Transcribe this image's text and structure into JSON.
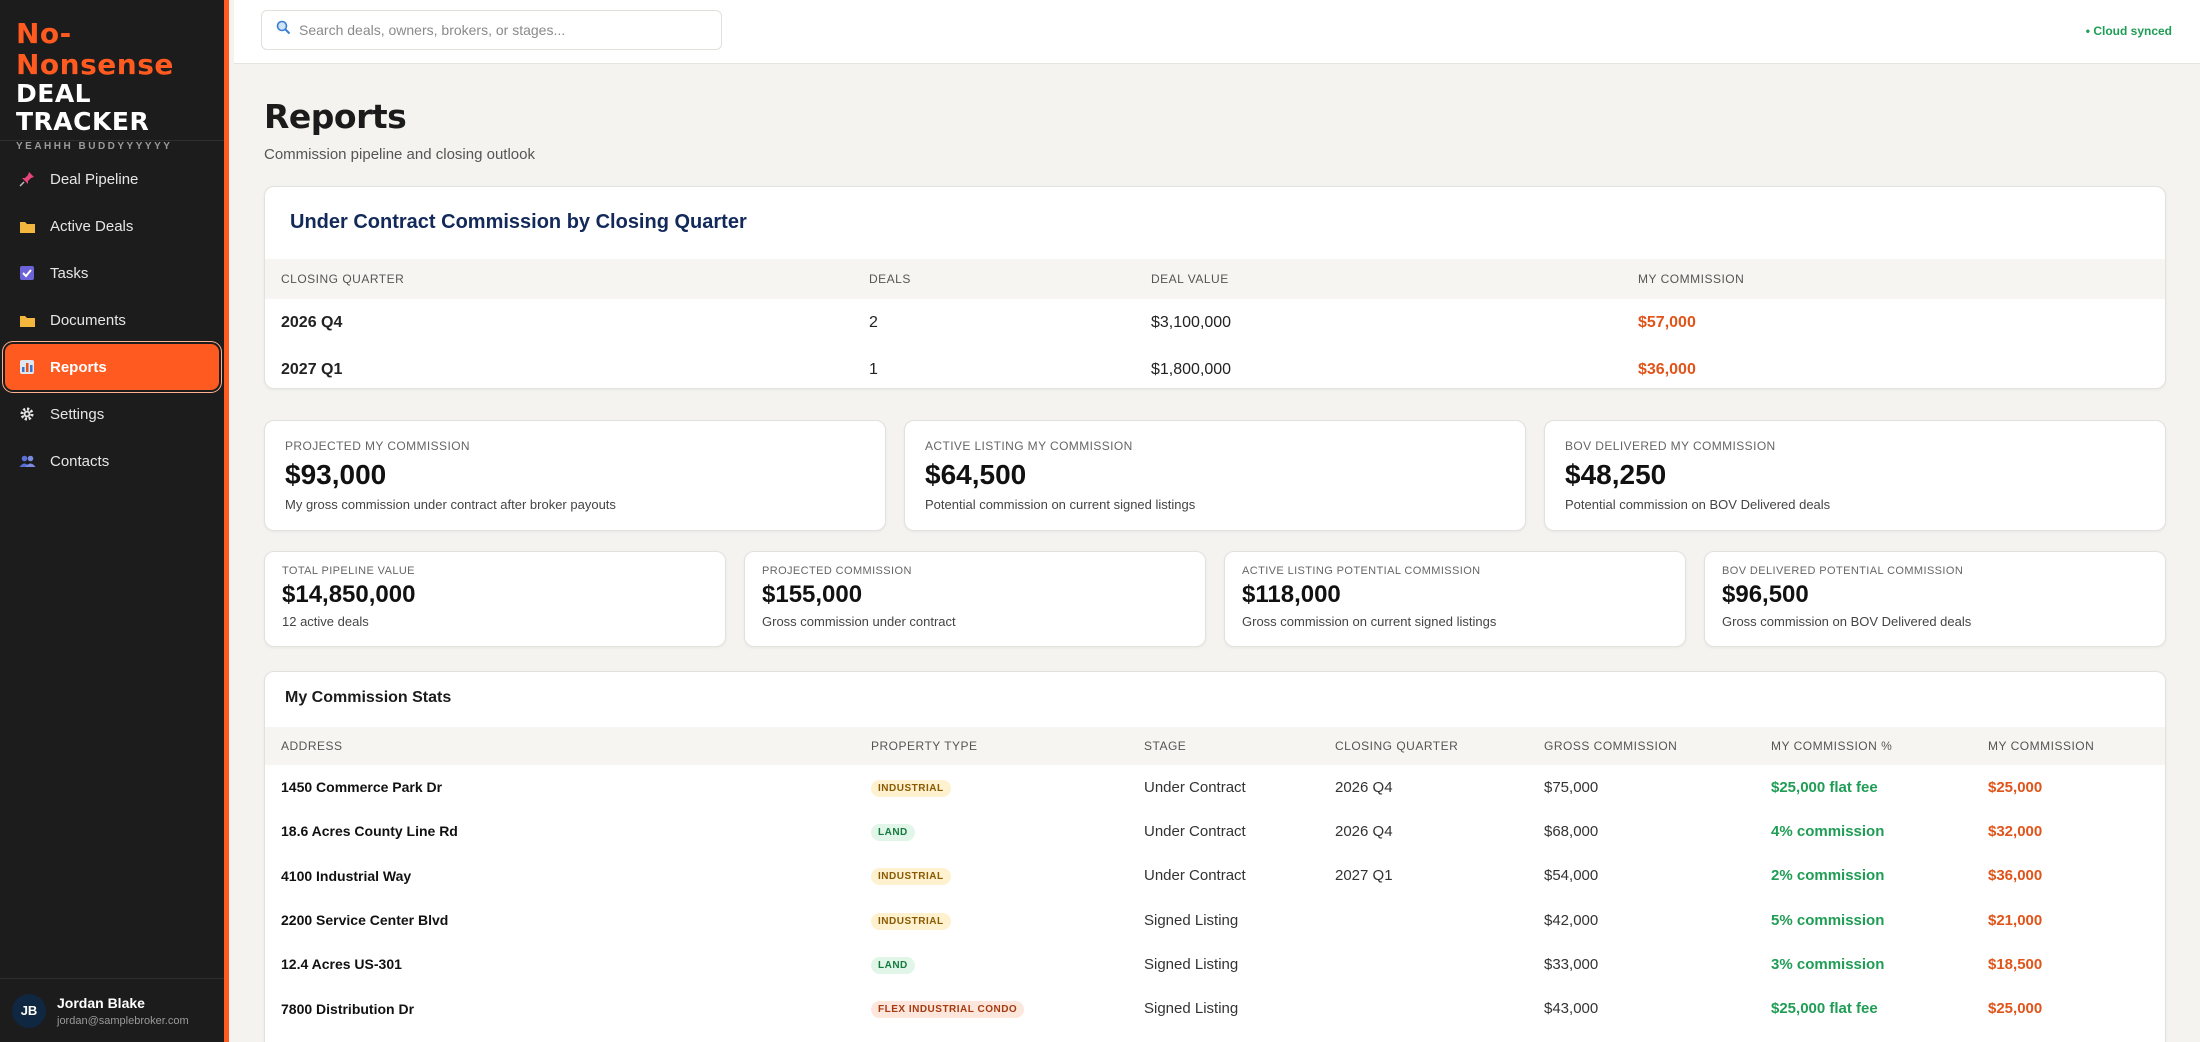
{
  "brand": {
    "line1": "No-",
    "line1b": "Nonsense",
    "line2": "DEAL TRACKER",
    "tagline": "YEAHHH BUDDYYYYYY"
  },
  "nav": {
    "items": [
      {
        "label": "Deal Pipeline",
        "icon": "pushpin-icon"
      },
      {
        "label": "Active Deals",
        "icon": "folder-icon"
      },
      {
        "label": "Tasks",
        "icon": "checkbox-icon"
      },
      {
        "label": "Documents",
        "icon": "folder-icon"
      },
      {
        "label": "Reports",
        "icon": "bar-chart-icon",
        "active": true
      },
      {
        "label": "Settings",
        "icon": "gear-icon"
      },
      {
        "label": "Contacts",
        "icon": "people-icon"
      }
    ]
  },
  "user": {
    "initials": "JB",
    "name": "Jordan Blake",
    "email": "jordan@samplebroker.com"
  },
  "topbar": {
    "search_placeholder": "Search deals, owners, brokers, or stages...",
    "sync_status": "• Cloud synced"
  },
  "page": {
    "title": "Reports",
    "subtitle": "Commission pipeline and closing outlook"
  },
  "quarter_table": {
    "title": "Under Contract Commission by Closing Quarter",
    "headers": [
      "CLOSING QUARTER",
      "DEALS",
      "DEAL VALUE",
      "MY COMMISSION"
    ],
    "rows": [
      {
        "quarter": "2026 Q4",
        "deals": "2",
        "value": "$3,100,000",
        "commission": "$57,000"
      },
      {
        "quarter": "2027 Q1",
        "deals": "1",
        "value": "$1,800,000",
        "commission": "$36,000"
      }
    ]
  },
  "stats_top": [
    {
      "label": "PROJECTED MY COMMISSION",
      "value": "$93,000",
      "sub": "My gross commission under contract after broker payouts"
    },
    {
      "label": "ACTIVE LISTING MY COMMISSION",
      "value": "$64,500",
      "sub": "Potential commission on current signed listings"
    },
    {
      "label": "BOV DELIVERED MY COMMISSION",
      "value": "$48,250",
      "sub": "Potential commission on BOV Delivered deals"
    }
  ],
  "stats_bottom": [
    {
      "label": "TOTAL PIPELINE VALUE",
      "value": "$14,850,000",
      "sub": "12 active deals"
    },
    {
      "label": "PROJECTED COMMISSION",
      "value": "$155,000",
      "sub": "Gross commission under contract"
    },
    {
      "label": "ACTIVE LISTING POTENTIAL COMMISSION",
      "value": "$118,000",
      "sub": "Gross commission on current signed listings"
    },
    {
      "label": "BOV DELIVERED POTENTIAL COMMISSION",
      "value": "$96,500",
      "sub": "Gross commission on BOV Delivered deals"
    }
  ],
  "commission_table": {
    "title": "My Commission Stats",
    "headers": [
      "ADDRESS",
      "PROPERTY TYPE",
      "STAGE",
      "CLOSING QUARTER",
      "GROSS COMMISSION",
      "MY COMMISSION %",
      "MY COMMISSION"
    ],
    "rows": [
      {
        "address": "1450 Commerce Park Dr",
        "type": "INDUSTRIAL",
        "stage": "Under Contract",
        "quarter": "2026 Q4",
        "gross": "$75,000",
        "pct": "$25,000 flat fee",
        "mine": "$25,000"
      },
      {
        "address": "18.6 Acres County Line Rd",
        "type": "LAND",
        "stage": "Under Contract",
        "quarter": "2026 Q4",
        "gross": "$68,000",
        "pct": "4% commission",
        "mine": "$32,000"
      },
      {
        "address": "4100 Industrial Way",
        "type": "INDUSTRIAL",
        "stage": "Under Contract",
        "quarter": "2027 Q1",
        "gross": "$54,000",
        "pct": "2% commission",
        "mine": "$36,000"
      },
      {
        "address": "2200 Service Center Blvd",
        "type": "INDUSTRIAL",
        "stage": "Signed Listing",
        "quarter": "",
        "gross": "$42,000",
        "pct": "5% commission",
        "mine": "$21,000"
      },
      {
        "address": "12.4 Acres US-301",
        "type": "LAND",
        "stage": "Signed Listing",
        "quarter": "",
        "gross": "$33,000",
        "pct": "3% commission",
        "mine": "$18,500"
      },
      {
        "address": "7800 Distribution Dr",
        "type": "FLEX INDUSTRIAL CONDO",
        "stage": "Signed Listing",
        "quarter": "",
        "gross": "$43,000",
        "pct": "$25,000 flat fee",
        "mine": "$25,000"
      }
    ]
  },
  "colors": {
    "accent": "#ff5a1f",
    "sidebar_bg": "#1c1c1c",
    "commission_orange": "#e0541a",
    "positive_green": "#1f9d55",
    "heading_navy": "#12295a"
  }
}
